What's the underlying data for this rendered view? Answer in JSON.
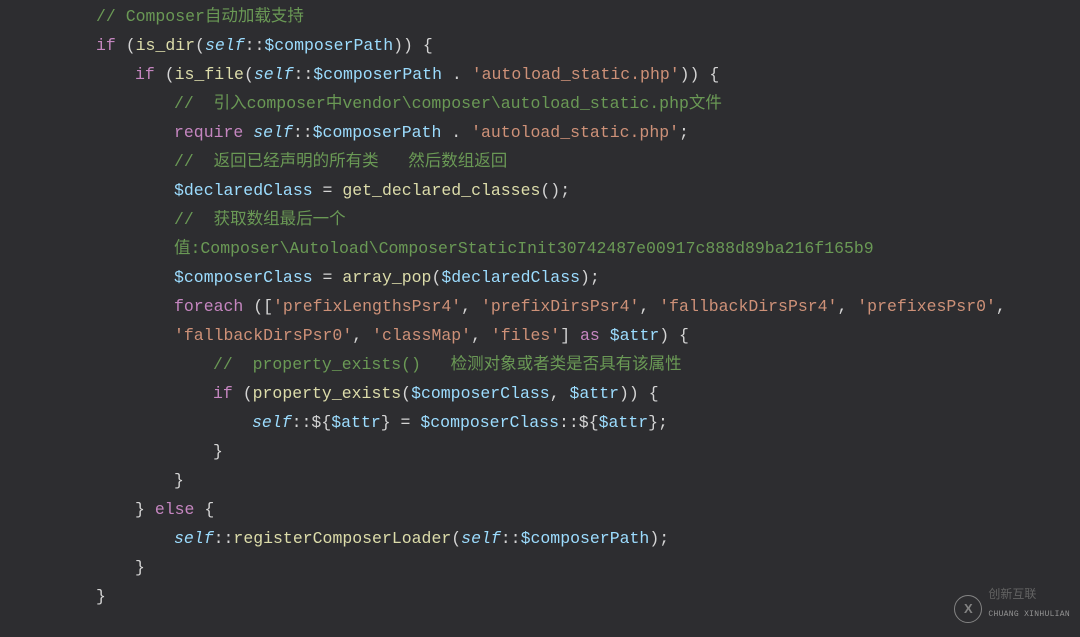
{
  "code": {
    "l1": {
      "c": "// Composer自动加载支持"
    },
    "l2": {
      "kw1": "if",
      "p1": " (",
      "fn": "is_dir",
      "p2": "(",
      "s": "self",
      "sc": "::",
      "v": "$composerPath",
      "p3": ")) {"
    },
    "l3": {
      "kw1": "if",
      "p1": " (",
      "fn": "is_file",
      "p2": "(",
      "s": "self",
      "sc": "::",
      "v": "$composerPath",
      "d": " . ",
      "str": "'autoload_static.php'",
      "p3": ")) {"
    },
    "l4": {
      "c": "//  引入composer中vendor\\composer\\autoload_static.php文件"
    },
    "l5": {
      "kw": "require",
      "sp": " ",
      "s": "self",
      "sc": "::",
      "v": "$composerPath",
      "d": " . ",
      "str": "'autoload_static.php'",
      "p": ";"
    },
    "l6": {
      "c": "//  返回已经声明的所有类   然后数组返回"
    },
    "l7": {
      "v": "$declaredClass",
      "eq": " = ",
      "fn": "get_declared_classes",
      "p": "();"
    },
    "l8": {
      "c": "//  获取数组最后一个"
    },
    "l8b": {
      "c": "值:Composer\\Autoload\\ComposerStaticInit30742487e00917c888d89ba216f165b9"
    },
    "l9": {
      "v": "$composerClass",
      "eq": " = ",
      "fn": "array_pop",
      "p1": "(",
      "v2": "$declaredClass",
      "p2": ");"
    },
    "l10": {
      "kw": "foreach",
      "p1": " ([",
      "s1": "'prefixLengthsPsr4'",
      "c1": ", ",
      "s2": "'prefixDirsPsr4'",
      "c2": ", ",
      "s3": "'fallbackDirsPsr4'",
      "c3": ", ",
      "s4": "'prefixesPsr0'",
      "c4": ","
    },
    "l10b": {
      "s5": "'fallbackDirsPsr0'",
      "c5": ", ",
      "s6": "'classMap'",
      "c6": ", ",
      "s7": "'files'",
      "p2": "] ",
      "kw2": "as",
      "sp": " ",
      "v": "$attr",
      "p3": ") {"
    },
    "l11": {
      "c": "//  property_exists()   检测对象或者类是否具有该属性"
    },
    "l12": {
      "kw": "if",
      "p1": " (",
      "fn": "property_exists",
      "p2": "(",
      "v1": "$composerClass",
      "c": ", ",
      "v2": "$attr",
      "p3": ")) {"
    },
    "l13": {
      "s": "self",
      "sc": "::",
      "d1": "${",
      "v1": "$attr",
      "d2": "} = ",
      "v2": "$composerClass",
      "sc2": "::",
      "d3": "${",
      "v3": "$attr",
      "d4": "};"
    },
    "l14": {
      "b": "}"
    },
    "l15": {
      "b": "}"
    },
    "l16": {
      "b": "} ",
      "kw": "else",
      "b2": " {"
    },
    "l17": {
      "s": "self",
      "sc": "::",
      "fn": "registerComposerLoader",
      "p1": "(",
      "s2": "self",
      "sc2": "::",
      "v": "$composerPath",
      "p2": ");"
    },
    "l18": {
      "b": "}"
    },
    "l19": {
      "b": "}"
    }
  },
  "watermark": {
    "logo": "X",
    "main": "创新互联",
    "sub": "CHUANG XINHULIAN"
  }
}
